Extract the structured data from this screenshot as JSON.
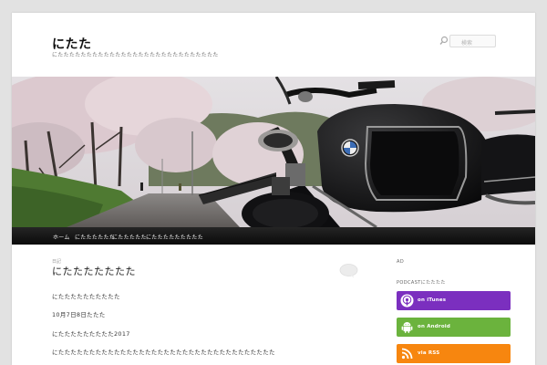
{
  "header": {
    "site_title": "にたた",
    "site_description": "にたたたたたたたたたたたたたたたたたたたたたたたたたたたた",
    "search_placeholder": "検索"
  },
  "nav": {
    "items": [
      {
        "label": "ホーム"
      },
      {
        "label": "にたたたたたた"
      },
      {
        "label": "にたたたたた"
      },
      {
        "label": "にたたたたたたたたた"
      }
    ]
  },
  "post": {
    "category": "日記",
    "title": "にたたたたたたた",
    "paragraphs": [
      "にたたたたたたたたたた",
      "10月7日8日たたた",
      "にたたたたたたたたた2017",
      "にたたたたたたたたたたたたたたたたたたたたたたたたたたたたたたたたたたた"
    ]
  },
  "sidebar": {
    "ad_label": "AD",
    "podcast_label": "PODCASTにたたたた",
    "badges": [
      {
        "label": "on iTunes",
        "color": "#7b2fbf",
        "icon": "podcast-icon"
      },
      {
        "label": "on Android",
        "color": "#6bb33d",
        "icon": "android-icon"
      },
      {
        "label": "via RSS",
        "color": "#f7860f",
        "icon": "rss-icon"
      }
    ]
  },
  "colors": {
    "background": "#e2e2e2",
    "nav_bar": "#1a1a1a",
    "itunes": "#7b2fbf",
    "android": "#6bb33d",
    "rss": "#f7860f"
  }
}
